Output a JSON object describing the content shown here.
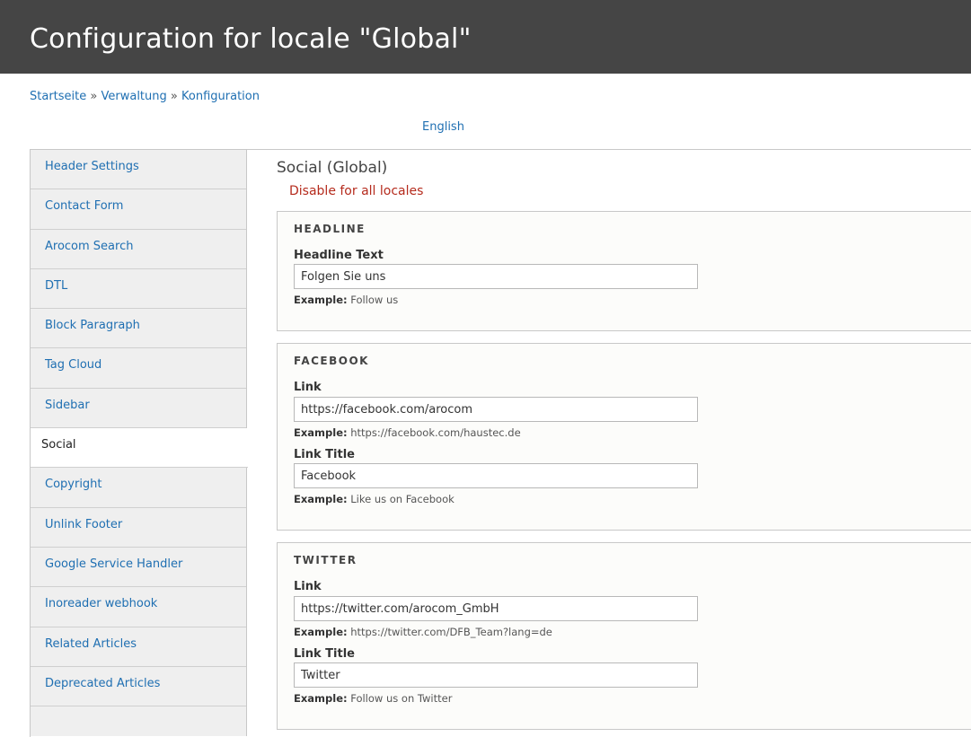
{
  "header": {
    "title": "Configuration for locale \"Global\""
  },
  "breadcrumb": {
    "items": [
      "Startseite",
      "Verwaltung",
      "Konfiguration"
    ],
    "separator": "»"
  },
  "language_link": "English",
  "sidebar": {
    "items": [
      {
        "label": "Header Settings"
      },
      {
        "label": "Contact Form"
      },
      {
        "label": "Arocom Search"
      },
      {
        "label": "DTL"
      },
      {
        "label": "Block Paragraph"
      },
      {
        "label": "Tag Cloud"
      },
      {
        "label": "Sidebar"
      },
      {
        "label": "Social",
        "active": true
      },
      {
        "label": "Copyright"
      },
      {
        "label": "Unlink Footer"
      },
      {
        "label": "Google Service Handler"
      },
      {
        "label": "Inoreader webhook"
      },
      {
        "label": "Related Articles"
      },
      {
        "label": "Deprecated Articles"
      }
    ]
  },
  "main": {
    "section_title": "Social (Global)",
    "disable_link": "Disable for all locales",
    "example_prefix": "Example:",
    "headline": {
      "legend": "HEADLINE",
      "text_label": "Headline Text",
      "text_value": "Folgen Sie uns",
      "text_example": "Follow us"
    },
    "facebook": {
      "legend": "FACEBOOK",
      "link_label": "Link",
      "link_value": "https://facebook.com/arocom",
      "link_example": "https://facebook.com/haustec.de",
      "title_label": "Link Title",
      "title_value": "Facebook",
      "title_example": "Like us on Facebook"
    },
    "twitter": {
      "legend": "TWITTER",
      "link_label": "Link",
      "link_value": "https://twitter.com/arocom_GmbH",
      "link_example": "https://twitter.com/DFB_Team?lang=de",
      "title_label": "Link Title",
      "title_value": "Twitter",
      "title_example": "Follow us on Twitter"
    }
  },
  "colors": {
    "header_bg": "#454545",
    "link": "#1f6fb2",
    "danger": "#b52b1d",
    "sidebar_bg": "#efefef"
  }
}
